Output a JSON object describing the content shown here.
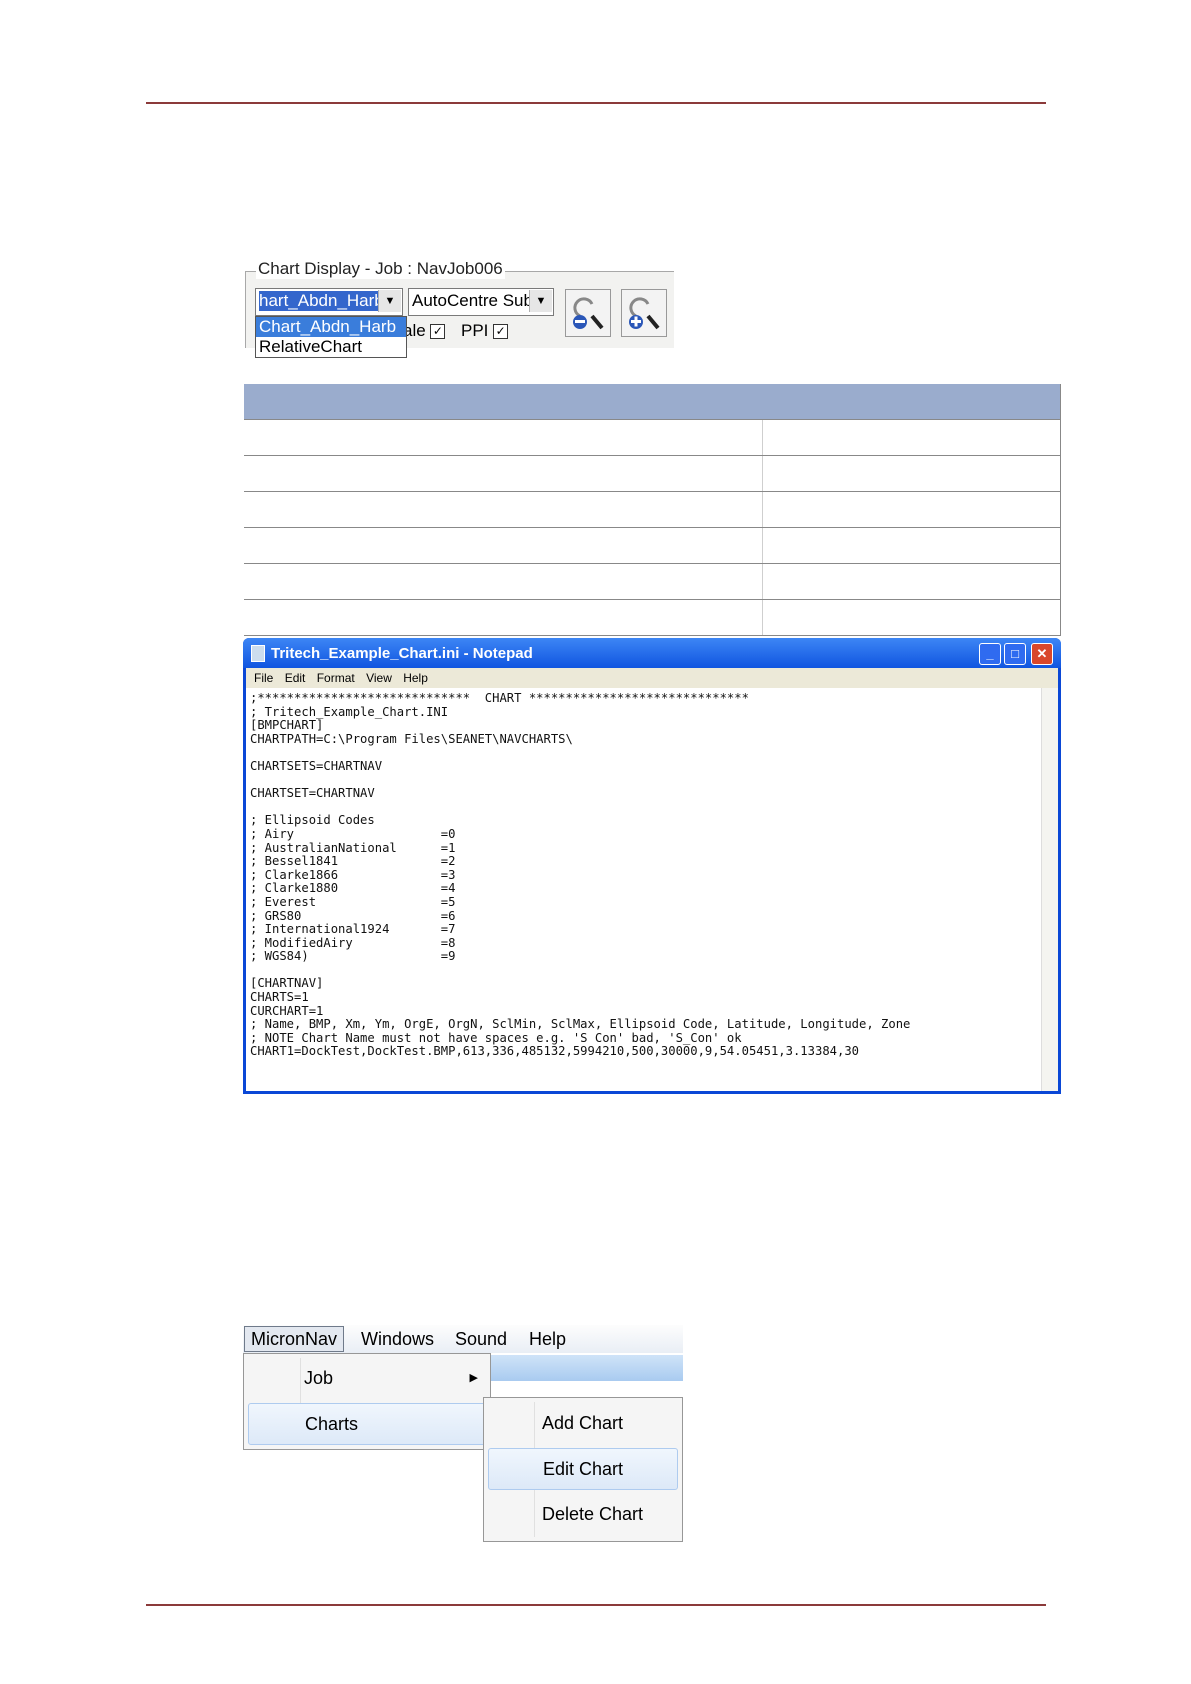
{
  "chart_display": {
    "legend": "Chart Display - Job : NavJob006",
    "chart_combo_value": "hart_Abdn_Harb",
    "dropdown_options": [
      "Chart_Abdn_Harb",
      "RelativeChart"
    ],
    "autocentre_value": "AutoCentre Sub",
    "scale_label": "ale",
    "ppi_label": "PPI",
    "check_mark": "✓",
    "zoom_out_icon": "zoom-out-icon",
    "zoom_in_icon": "zoom-in-icon"
  },
  "table": {
    "header_color": "#9aaccd",
    "rows": 6
  },
  "notepad": {
    "title": "Tritech_Example_Chart.ini - Notepad",
    "menu": [
      "File",
      "Edit",
      "Format",
      "View",
      "Help"
    ],
    "content": ";*****************************  CHART ******************************\n; Tritech_Example_Chart.INI\n[BMPCHART]\nCHARTPATH=C:\\Program Files\\SEANET\\NAVCHARTS\\\n\nCHARTSETS=CHARTNAV\n\nCHARTSET=CHARTNAV\n\n; Ellipsoid Codes\n; Airy                    =0\n; AustralianNational      =1\n; Bessel1841              =2\n; Clarke1866              =3\n; Clarke1880              =4\n; Everest                 =5\n; GRS80                   =6\n; International1924       =7\n; ModifiedAiry            =8\n; WGS84)                  =9\n\n[CHARTNAV]\nCHARTS=1\nCURCHART=1\n; Name, BMP, Xm, Ym, OrgE, OrgN, SclMin, SclMax, Ellipsoid Code, Latitude, Longitude, Zone\n; NOTE Chart Name must not have spaces e.g. 'S Con' bad, 'S_Con' ok\nCHART1=DockTest,DockTest.BMP,613,336,485132,5994210,500,30000,9,54.05451,3.13384,30",
    "minimize": "_",
    "maximize": "□",
    "close": "✕"
  },
  "micronnav_menu": {
    "menubar": [
      "MicronNav",
      "Windows",
      "Sound",
      "Help"
    ],
    "main_items": [
      "Job",
      "Charts"
    ],
    "submenu_arrow": "▶",
    "submenu_items": [
      "Add Chart",
      "Edit Chart",
      "Delete Chart"
    ]
  }
}
